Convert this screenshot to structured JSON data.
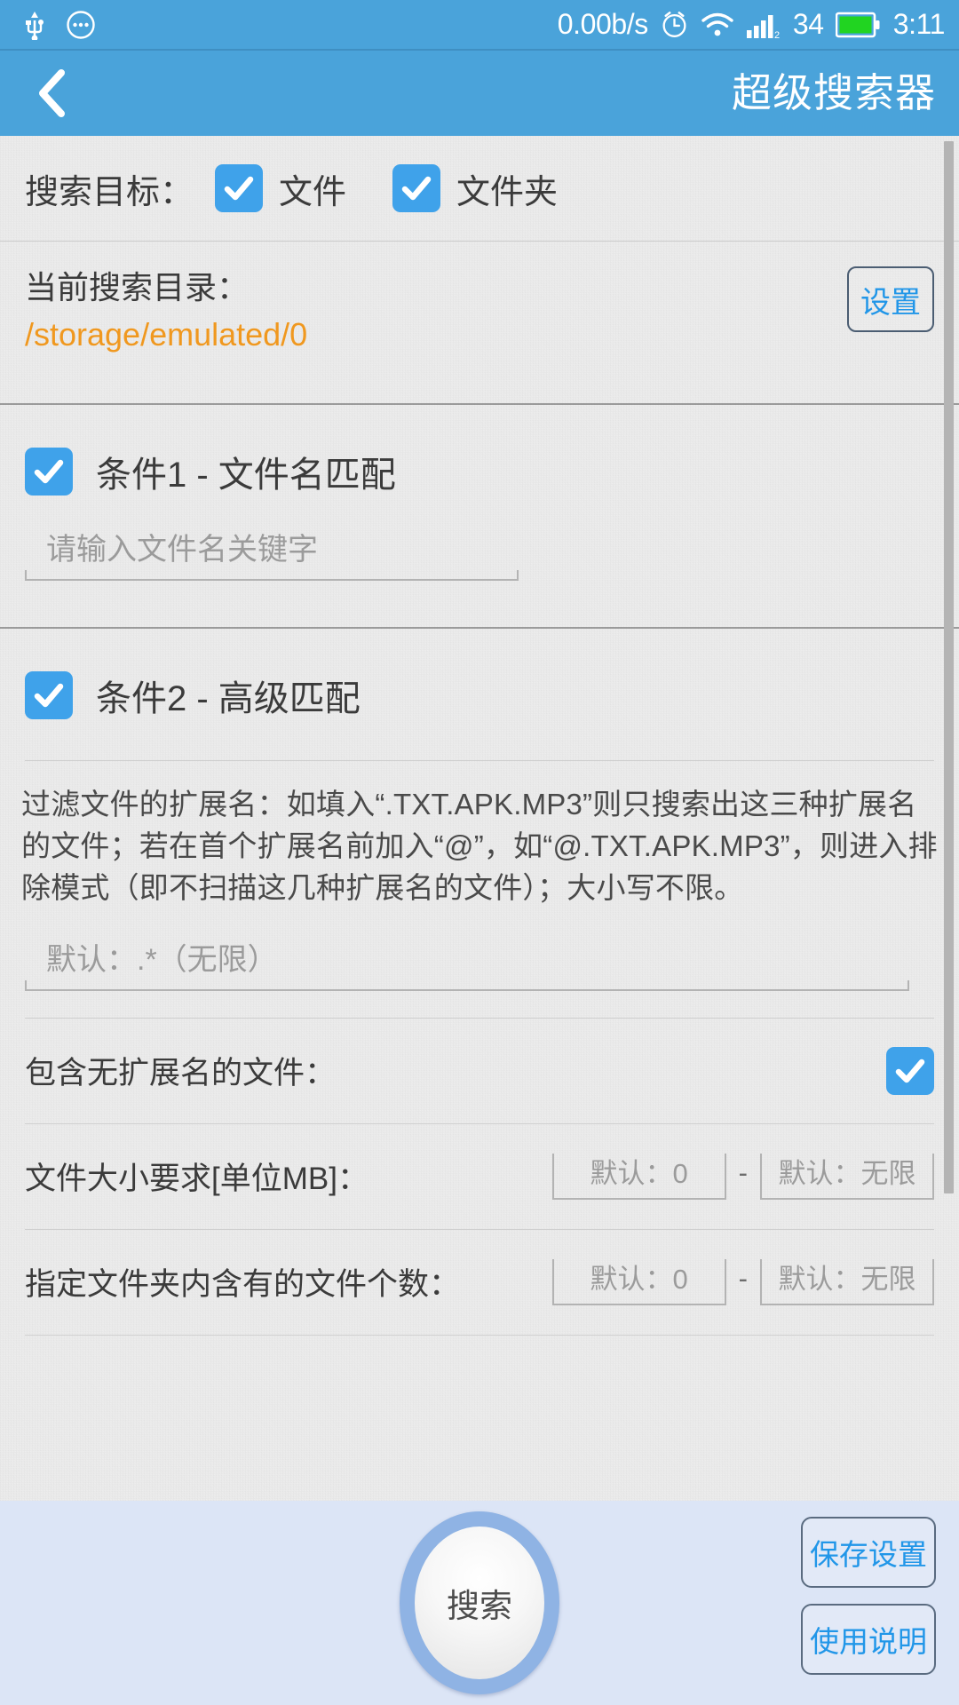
{
  "status_bar": {
    "usb_icon": "usb-icon",
    "more_icon": "more-circle-icon",
    "network_speed": "0.00b/s",
    "alarm_icon": "alarm-clock-icon",
    "wifi_icon": "wifi-icon",
    "signal_icon": "signal-bars-icon",
    "battery_level": "34",
    "battery_icon": "battery-icon",
    "time": "3:11",
    "bar_color": "#4aa3da",
    "battery_color": "#21d421"
  },
  "app_bar": {
    "back_icon": "chevron-left-icon",
    "title": "超级搜索器",
    "color": "#4aa3da"
  },
  "search_target": {
    "label": "搜索目标：",
    "options": [
      {
        "label": "文件",
        "checked": true
      },
      {
        "label": "文件夹",
        "checked": true
      }
    ]
  },
  "current_dir": {
    "label": "当前搜索目录：",
    "path": "/storage/emulated/0",
    "path_color": "#f0981f",
    "settings_button": "设置"
  },
  "condition1": {
    "title": "条件1 - 文件名匹配",
    "checked": true,
    "input_placeholder": "请输入文件名关键字",
    "input_value": ""
  },
  "condition2": {
    "title": "条件2 - 高级匹配",
    "checked": true,
    "description": "过滤文件的扩展名：如填入“.TXT.APK.MP3”则只搜索出这三种扩展名的文件；若在首个扩展名前加入“@”，如“@.TXT.APK.MP3”，则进入排除模式（即不扫描这几种扩展名的文件）；大小写不限。",
    "ext_placeholder": "默认：.*（无限）",
    "ext_value": "",
    "no_ext_label": "包含无扩展名的文件：",
    "no_ext_checked": true,
    "filesize_label": "文件大小要求[单位MB]：",
    "filesize_min_placeholder": "默认：0",
    "filesize_max_placeholder": "默认：无限",
    "range_dash": "-",
    "filecount_label": "指定文件夹内含有的文件个数：",
    "filecount_min_placeholder": "默认：0",
    "filecount_max_placeholder": "默认：无限"
  },
  "bottom_bar": {
    "search_button": "搜索",
    "save_button": "保存设置",
    "help_button": "使用说明",
    "background": "#dce5f6",
    "accent": "#2196e8"
  }
}
